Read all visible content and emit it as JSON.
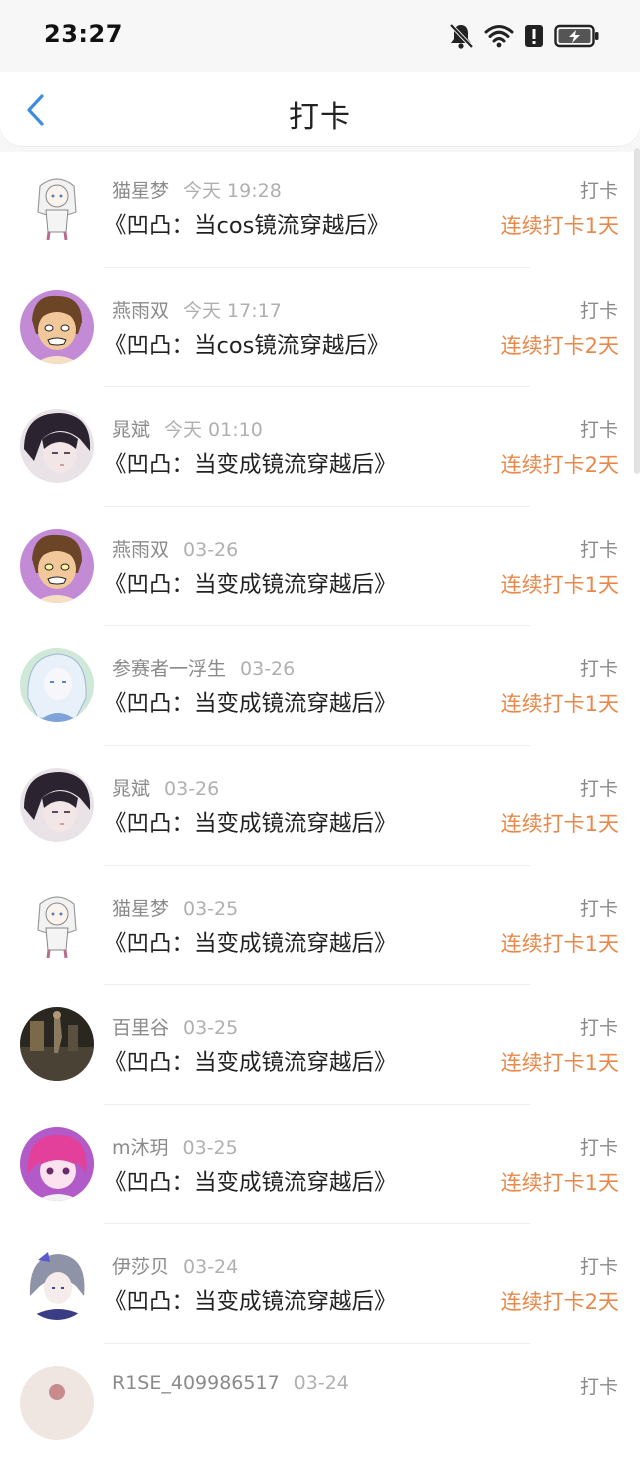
{
  "status_bar": {
    "time": "23:27",
    "icons": [
      "bell-muted-icon",
      "wifi-icon",
      "alert-icon",
      "battery-charging-icon"
    ]
  },
  "header": {
    "back_icon": "chevron-left-icon",
    "title": "打卡"
  },
  "colors": {
    "accent_orange": "#e8884a",
    "back_blue": "#3d8ddc"
  },
  "checkins": [
    {
      "user": "猫星梦",
      "time": "今天 19:28",
      "book": "《凹凸：当cos镜流穿越后》",
      "action": "打卡",
      "streak": "连续打卡1天",
      "avatar": "avatar-sketch-girl"
    },
    {
      "user": "燕雨双",
      "time": "今天 17:17",
      "book": "《凹凸：当cos镜流穿越后》",
      "action": "打卡",
      "streak": "连续打卡2天",
      "avatar": "avatar-angry-boy"
    },
    {
      "user": "晁斌",
      "time": "今天 01:10",
      "book": "《凹凸：当变成镜流穿越后》",
      "action": "打卡",
      "streak": "连续打卡2天",
      "avatar": "avatar-dark-hair"
    },
    {
      "user": "燕雨双",
      "time": "03-26",
      "book": "《凹凸：当变成镜流穿越后》",
      "action": "打卡",
      "streak": "连续打卡1天",
      "avatar": "avatar-angry-boy"
    },
    {
      "user": "参赛者一浮生",
      "time": "03-26",
      "book": "《凹凸：当变成镜流穿越后》",
      "action": "打卡",
      "streak": "连续打卡1天",
      "avatar": "avatar-white-hair"
    },
    {
      "user": "晁斌",
      "time": "03-26",
      "book": "《凹凸：当变成镜流穿越后》",
      "action": "打卡",
      "streak": "连续打卡1天",
      "avatar": "avatar-dark-hair"
    },
    {
      "user": "猫星梦",
      "time": "03-25",
      "book": "《凹凸：当变成镜流穿越后》",
      "action": "打卡",
      "streak": "连续打卡1天",
      "avatar": "avatar-sketch-girl"
    },
    {
      "user": "百里谷",
      "time": "03-25",
      "book": "《凹凸：当变成镜流穿越后》",
      "action": "打卡",
      "streak": "连续打卡1天",
      "avatar": "avatar-dark-scene"
    },
    {
      "user": "m沐玥",
      "time": "03-25",
      "book": "《凹凸：当变成镜流穿越后》",
      "action": "打卡",
      "streak": "连续打卡1天",
      "avatar": "avatar-pink-girl"
    },
    {
      "user": "伊莎贝",
      "time": "03-24",
      "book": "《凹凸：当变成镜流穿越后》",
      "action": "打卡",
      "streak": "连续打卡2天",
      "avatar": "avatar-silver-hair"
    },
    {
      "user": "R1SE_409986517",
      "time": "03-24",
      "book": "",
      "action": "打卡",
      "streak": "",
      "avatar": "avatar-partial"
    }
  ]
}
